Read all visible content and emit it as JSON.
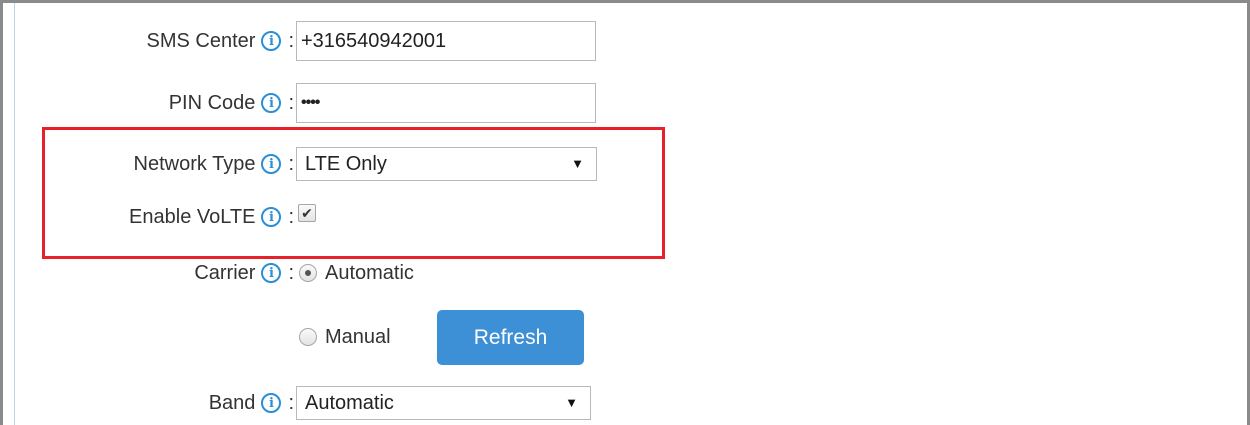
{
  "form": {
    "sms_center": {
      "label": "SMS Center",
      "value": "+316540942001"
    },
    "pin_code": {
      "label": "PIN Code",
      "value": "••••"
    },
    "network_type": {
      "label": "Network Type",
      "selected": "LTE Only"
    },
    "enable_volte": {
      "label": "Enable VoLTE",
      "checked": true,
      "check_glyph": "✔"
    },
    "carrier": {
      "label": "Carrier",
      "option_automatic": "Automatic",
      "option_manual": "Manual",
      "selected": "Automatic",
      "refresh_label": "Refresh"
    },
    "band": {
      "label": "Band",
      "selected": "Automatic"
    },
    "colon": ":",
    "info_glyph": "i",
    "caret_glyph": "▼"
  },
  "colors": {
    "accent_blue": "#2a8fd6",
    "button_blue": "#3d8fd6",
    "highlight_red": "#e8202a"
  },
  "icons": [
    "info-icon",
    "dropdown-caret-icon",
    "checkmark-icon"
  ]
}
